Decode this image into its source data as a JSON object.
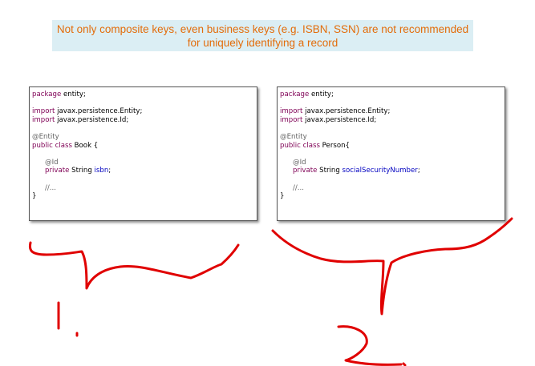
{
  "banner": {
    "line1": "Not only composite keys, even business keys (e.g. ISBN, SSN) are not recommended",
    "line2": "for uniquely identifying a record"
  },
  "colors": {
    "banner_bg": "#dbeef4",
    "banner_text": "#e36c0a",
    "keyword": "#7f0055",
    "annotation": "#646464",
    "field": "#0000c0",
    "ink": "#e00000"
  },
  "code_left": {
    "pkg_kw": "package",
    "pkg_rest": " entity;",
    "imp1_kw": "import",
    "imp1_rest": " javax.persistence.Entity;",
    "imp2_kw": "import",
    "imp2_rest": " javax.persistence.Id;",
    "ann_entity": "@Entity",
    "class_kw": "public class",
    "class_rest": " Book {",
    "ann_id": "@Id",
    "field_kw": "private",
    "field_type": " String ",
    "field_name": "isbn",
    "field_end": ";",
    "comment": "//...",
    "close": "}"
  },
  "code_right": {
    "pkg_kw": "package",
    "pkg_rest": " entity;",
    "imp1_kw": "import",
    "imp1_rest": " javax.persistence.Entity;",
    "imp2_kw": "import",
    "imp2_rest": " javax.persistence.Id;",
    "ann_entity": "@Entity",
    "class_kw": "public class",
    "class_rest": " Person{",
    "ann_id": "@Id",
    "field_kw": "private",
    "field_type": " String ",
    "field_name": "socialSecurityNumber",
    "field_end": ";",
    "comment": "//...",
    "close": "}"
  },
  "annotations": {
    "ink_color": "#e00000",
    "marks": [
      "brace-under-left-box",
      "number-1",
      "brace-under-right-box",
      "number-2"
    ]
  }
}
